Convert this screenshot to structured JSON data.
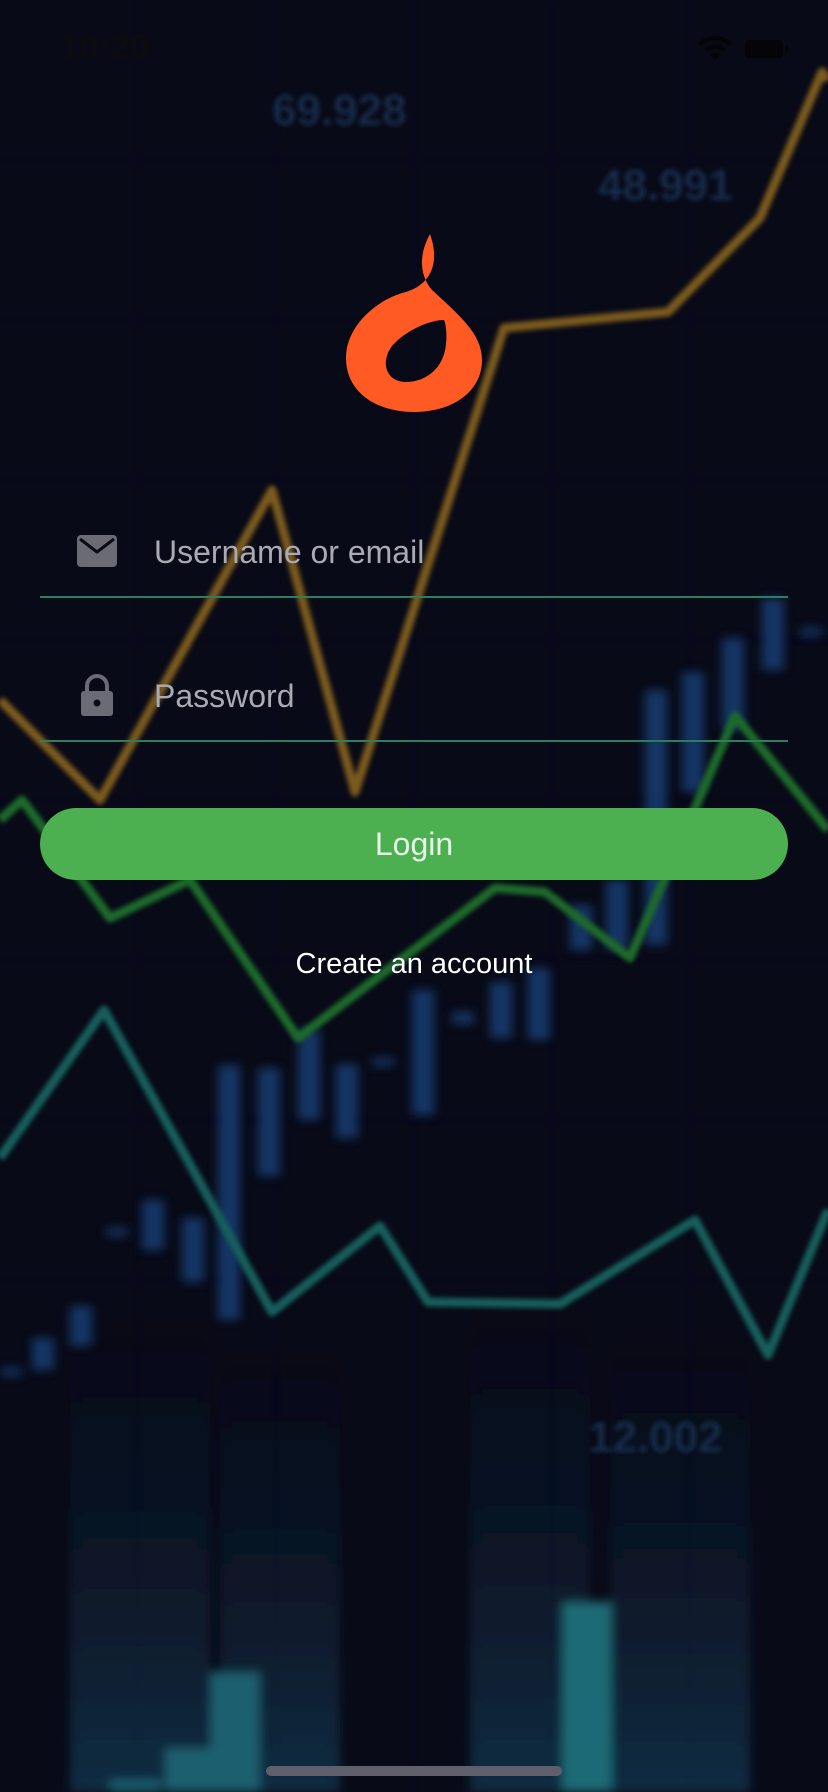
{
  "status_bar": {
    "time": "10:20",
    "icons": [
      "wifi-icon",
      "battery-icon"
    ]
  },
  "background": {
    "numbers": [
      "69.928",
      "48.991",
      "12.002"
    ]
  },
  "logo": {
    "icon": "flame-icon",
    "color": "#ff5a23"
  },
  "login_form": {
    "username": {
      "icon": "mail-icon",
      "placeholder": "Username or email",
      "value": ""
    },
    "password": {
      "icon": "lock-icon",
      "placeholder": "Password",
      "value": ""
    },
    "underline_color": "#2f7d5f",
    "login_label": "Login",
    "login_color": "#4caf50",
    "create_account_label": "Create an account"
  }
}
